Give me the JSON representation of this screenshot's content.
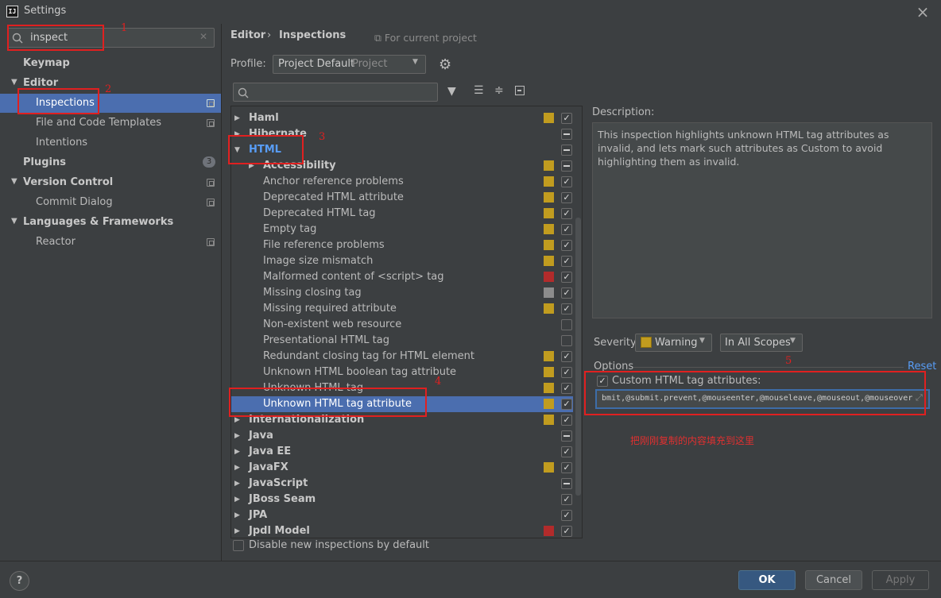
{
  "window": {
    "title": "Settings",
    "app_icon": "IJ"
  },
  "left": {
    "search_value": "inspect",
    "items": [
      {
        "label": "Keymap"
      },
      {
        "label": "Editor"
      },
      {
        "label": "Inspections"
      },
      {
        "label": "File and Code Templates"
      },
      {
        "label": "Intentions"
      },
      {
        "label": "Plugins",
        "badge": "3"
      },
      {
        "label": "Version Control"
      },
      {
        "label": "Commit Dialog"
      },
      {
        "label": "Languages & Frameworks"
      },
      {
        "label": "Reactor"
      }
    ]
  },
  "header": {
    "crumb1": "Editor",
    "crumb_sep": "›",
    "crumb2": "Inspections",
    "project_note": "For current project",
    "profile_label": "Profile:",
    "profile_value": "Project Default",
    "profile_scope": "Project"
  },
  "tree": {
    "rows": [
      {
        "label": "Haml",
        "sev": "#c19c1f",
        "check": "checked"
      },
      {
        "label": "Hibernate",
        "sev": "",
        "check": "partial"
      },
      {
        "label": "HTML",
        "sev": "",
        "check": "partial"
      },
      {
        "label": "Accessibility",
        "sev": "#c19c1f",
        "check": "partial"
      },
      {
        "label": "Anchor reference problems",
        "sev": "#c19c1f",
        "check": "checked"
      },
      {
        "label": "Deprecated HTML attribute",
        "sev": "#c19c1f",
        "check": "checked"
      },
      {
        "label": "Deprecated HTML tag",
        "sev": "#c19c1f",
        "check": "checked"
      },
      {
        "label": "Empty tag",
        "sev": "#c19c1f",
        "check": "checked"
      },
      {
        "label": "File reference problems",
        "sev": "#c19c1f",
        "check": "checked"
      },
      {
        "label": "Image size mismatch",
        "sev": "#c19c1f",
        "check": "checked"
      },
      {
        "label": "Malformed content of <script> tag",
        "sev": "#b22b2b",
        "check": "checked"
      },
      {
        "label": "Missing closing tag",
        "sev": "#8c8c8c",
        "check": "checked"
      },
      {
        "label": "Missing required attribute",
        "sev": "#c19c1f",
        "check": "checked"
      },
      {
        "label": "Non-existent web resource",
        "sev": "",
        "check": "unchecked"
      },
      {
        "label": "Presentational HTML tag",
        "sev": "",
        "check": "unchecked"
      },
      {
        "label": "Redundant closing tag for HTML element",
        "sev": "#c19c1f",
        "check": "checked"
      },
      {
        "label": "Unknown HTML boolean tag attribute",
        "sev": "#c19c1f",
        "check": "checked"
      },
      {
        "label": "Unknown HTML tag",
        "sev": "#c19c1f",
        "check": "checked"
      },
      {
        "label": "Unknown HTML tag attribute",
        "sev": "#c19c1f",
        "check": "checked"
      },
      {
        "label": "Internationalization",
        "sev": "#c19c1f",
        "check": "checked"
      },
      {
        "label": "Java",
        "sev": "",
        "check": "partial"
      },
      {
        "label": "Java EE",
        "sev": "",
        "check": "checked"
      },
      {
        "label": "JavaFX",
        "sev": "#c19c1f",
        "check": "checked"
      },
      {
        "label": "JavaScript",
        "sev": "",
        "check": "partial"
      },
      {
        "label": "JBoss Seam",
        "sev": "",
        "check": "checked"
      },
      {
        "label": "JPA",
        "sev": "",
        "check": "checked"
      },
      {
        "label": "Jpdl Model",
        "sev": "#b22b2b",
        "check": "checked"
      }
    ],
    "disable_new_label": "Disable new inspections by default"
  },
  "details": {
    "description_label": "Description:",
    "description_text": "This inspection highlights unknown HTML tag attributes as invalid, and lets mark such attributes as Custom to avoid highlighting them as invalid.",
    "severity_label": "Severity:",
    "severity_value": "Warning",
    "scope_value": "In All Scopes",
    "options_label": "Options",
    "reset_label": "Reset",
    "custom_attr_label": "Custom HTML tag attributes:",
    "custom_attr_value": "bmit,@submit.prevent,@mouseenter,@mouseleave,@mouseout,@mouseover",
    "chinese_note": "把刚刚复制的内容填充到这里"
  },
  "annotations": [
    "1",
    "2",
    "3",
    "4",
    "5"
  ],
  "buttons": {
    "help": "?",
    "ok": "OK",
    "cancel": "Cancel",
    "apply": "Apply"
  }
}
